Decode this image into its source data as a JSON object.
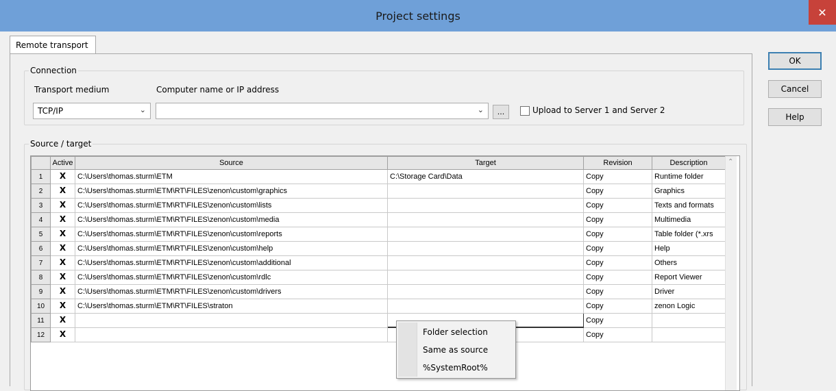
{
  "window": {
    "title": "Project settings",
    "close_glyph": "✕"
  },
  "tab": {
    "label": "Remote transport"
  },
  "buttons": {
    "ok": "OK",
    "cancel": "Cancel",
    "help": "Help"
  },
  "connection": {
    "group_label": "Connection",
    "transport_label": "Transport medium",
    "transport_value": "TCP/IP",
    "computer_label": "Computer name or IP address",
    "computer_value": "",
    "browse_label": "...",
    "upload_label": "Upload to Server 1 and Server 2",
    "upload_checked": false
  },
  "source_target": {
    "group_label": "Source / target",
    "columns": [
      "Active",
      "Source",
      "Target",
      "Revision",
      "Description"
    ],
    "rows": [
      {
        "num": "1",
        "active": true,
        "source": "C:\\Users\\thomas.sturm\\ETM",
        "target": "C:\\Storage Card\\Data",
        "revision": "Copy",
        "description": "Runtime folder"
      },
      {
        "num": "2",
        "active": true,
        "source": "C:\\Users\\thomas.sturm\\ETM\\RT\\FILES\\zenon\\custom\\graphics",
        "target": "",
        "revision": "Copy",
        "description": "Graphics"
      },
      {
        "num": "3",
        "active": true,
        "source": "C:\\Users\\thomas.sturm\\ETM\\RT\\FILES\\zenon\\custom\\lists",
        "target": "",
        "revision": "Copy",
        "description": "Texts and formats"
      },
      {
        "num": "4",
        "active": true,
        "source": "C:\\Users\\thomas.sturm\\ETM\\RT\\FILES\\zenon\\custom\\media",
        "target": "",
        "revision": "Copy",
        "description": "Multimedia"
      },
      {
        "num": "5",
        "active": true,
        "source": "C:\\Users\\thomas.sturm\\ETM\\RT\\FILES\\zenon\\custom\\reports",
        "target": "",
        "revision": "Copy",
        "description": "Table folder (*.xrs"
      },
      {
        "num": "6",
        "active": true,
        "source": "C:\\Users\\thomas.sturm\\ETM\\RT\\FILES\\zenon\\custom\\help",
        "target": "",
        "revision": "Copy",
        "description": "Help"
      },
      {
        "num": "7",
        "active": true,
        "source": "C:\\Users\\thomas.sturm\\ETM\\RT\\FILES\\zenon\\custom\\additional",
        "target": "",
        "revision": "Copy",
        "description": "Others"
      },
      {
        "num": "8",
        "active": true,
        "source": "C:\\Users\\thomas.sturm\\ETM\\RT\\FILES\\zenon\\custom\\rdlc",
        "target": "",
        "revision": "Copy",
        "description": "Report Viewer"
      },
      {
        "num": "9",
        "active": true,
        "source": "C:\\Users\\thomas.sturm\\ETM\\RT\\FILES\\zenon\\custom\\drivers",
        "target": "",
        "revision": "Copy",
        "description": "Driver"
      },
      {
        "num": "10",
        "active": true,
        "source": "C:\\Users\\thomas.sturm\\ETM\\RT\\FILES\\straton",
        "target": "",
        "revision": "Copy",
        "description": "zenon Logic"
      },
      {
        "num": "11",
        "active": true,
        "source": "",
        "target": "",
        "revision": "Copy",
        "description": ""
      },
      {
        "num": "12",
        "active": true,
        "source": "",
        "target": "",
        "revision": "Copy",
        "description": ""
      }
    ],
    "checked_glyph": "X"
  },
  "context_menu": {
    "items": [
      "Folder selection",
      "Same as source",
      "%SystemRoot%"
    ]
  },
  "icons": {
    "dropdown": "chevron-down-icon",
    "close": "close-icon",
    "scroll_up": "scroll-up-icon"
  }
}
